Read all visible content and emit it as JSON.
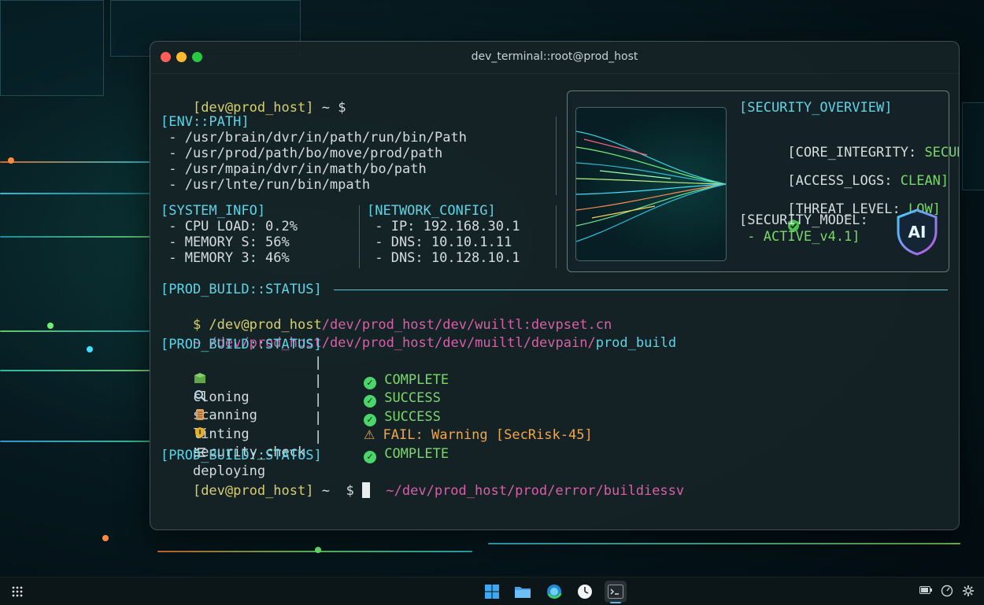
{
  "window": {
    "title": "dev_terminal::root@prod_host"
  },
  "prompt1": {
    "user": "[dev@prod_host]",
    "tilde": "~ $"
  },
  "env": {
    "header": "[ENV::PATH]",
    "paths": [
      " - /usr/brain/dvr/in/path/run/bin/Path",
      " - /usr/prod/path/bo/move/prod/path",
      " - /usr/mpain/dvr/in/math/bo/path",
      " - /usr/lnte/run/bin/mpath"
    ]
  },
  "system_info": {
    "header": "[SYSTEM_INFO]",
    "items": [
      " - CPU LOAD: 0.2%",
      " - MEMORY S: 56%",
      " - MEMORY 3: 46%"
    ]
  },
  "network_config": {
    "header": "[NETWORK_CONFIG]",
    "items": [
      " - IP: 192.168.30.1",
      " - DNS: 10.10.1.11",
      " - DNS: 10.128.10.1"
    ]
  },
  "security": {
    "header": "[SECURITY_OVERVIEW]",
    "core_integrity_label": "[CORE_INTEGRITY:",
    "core_integrity_value": "SECURED]",
    "access_logs_label": "[ACCESS_LOGS:",
    "access_logs_value": "CLEAN]",
    "threat_level_label": "[THREAT_LEVEL:",
    "threat_level_value": "LOW]",
    "security_model_label": "[SECURITY_MODEL:",
    "security_model_value": " - ACTIVE_v4.1]",
    "ai_badge_text": "AI"
  },
  "build": {
    "status_header": "[PROD_BUILD::STATUS]",
    "cmd1_prefix": "$ /dev@prod_host",
    "cmd1_path": "/dev/prod_host/dev/wuiltl:devpset.cn",
    "cmd2_prefix": "~ /dev/prod_host/dev/prod_host/dev/muiltl/devpain/",
    "cmd2_suffix": "prod_build",
    "steps": [
      {
        "name": "cloning",
        "icon": "package-icon",
        "result": "COMPLETE"
      },
      {
        "name": "scanning",
        "icon": "magnifier-icon",
        "result": "SUCCESS"
      },
      {
        "name": "linting",
        "icon": "scroll-icon",
        "result": "SUCCESS"
      },
      {
        "name": "security_check",
        "icon": "shield-icon",
        "result_label": "FAIL:",
        "result": "Warning [SecRisk-45]"
      },
      {
        "name": "deploying",
        "icon": "checklist-icon",
        "result": "COMPLETE"
      }
    ],
    "separator": "|"
  },
  "prompt2": {
    "user": "[dev@prod_host]",
    "tilde": "~  $",
    "path": "~/dev/prod_host/prod/error/buildiessv"
  },
  "colors": {
    "yellow": "#d8cf6b",
    "cyan": "#5fd3e6",
    "magenta": "#d95fa8",
    "green": "#7bd66a",
    "orange": "#f0a64a"
  },
  "taskbar": {
    "items": [
      "apps-grid-icon",
      "windows-start-icon",
      "file-explorer-icon",
      "browser-icon",
      "clock-icon",
      "terminal-icon"
    ],
    "tray": [
      "battery-icon",
      "gauge-icon",
      "gear-icon"
    ]
  }
}
